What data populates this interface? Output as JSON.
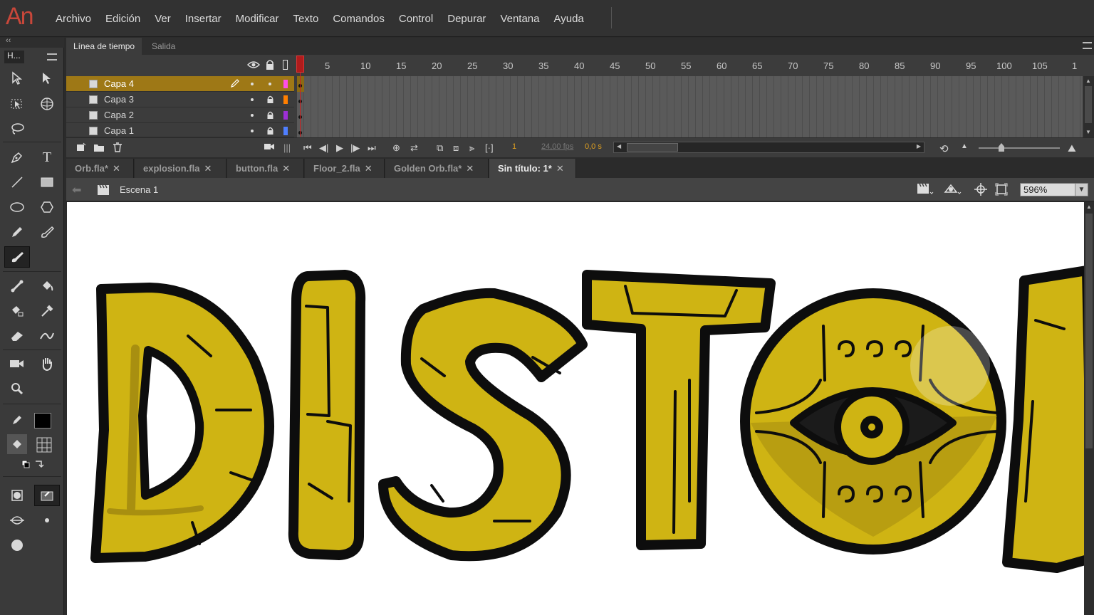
{
  "app": {
    "logo": "An"
  },
  "menu": [
    "Archivo",
    "Edición",
    "Ver",
    "Insertar",
    "Modificar",
    "Texto",
    "Comandos",
    "Control",
    "Depurar",
    "Ventana",
    "Ayuda"
  ],
  "toolbar": {
    "title": "H...",
    "tools": [
      "selection-icon",
      "subselection-icon",
      "free-transform-icon",
      "3d-rotation-icon",
      "lasso-icon",
      "pen-icon",
      "text-icon",
      "line-icon",
      "rectangle-icon",
      "oval-icon",
      "polystar-icon",
      "pencil-icon",
      "paint-brush-icon",
      "brush-icon",
      "bone-icon",
      "paint-bucket-icon",
      "ink-bottle-icon",
      "eyedropper-icon",
      "eraser-icon",
      "width-icon",
      "camera-icon",
      "hand-icon",
      "zoom-icon"
    ]
  },
  "timeline": {
    "tabs": [
      "Línea de tiempo",
      "Salida"
    ],
    "frame_numbers": [
      "1",
      "5",
      "10",
      "15",
      "20",
      "25",
      "30",
      "35",
      "40",
      "45",
      "50",
      "55",
      "60",
      "65",
      "70",
      "75",
      "80",
      "85",
      "90",
      "95",
      "100",
      "105",
      "1"
    ],
    "layers": [
      {
        "name": "Capa 4",
        "color": "#ff4ee8",
        "selected": true
      },
      {
        "name": "Capa 3",
        "color": "#ff7f00",
        "selected": false
      },
      {
        "name": "Capa 2",
        "color": "#9d2fd6",
        "selected": false
      },
      {
        "name": "Capa 1",
        "color": "#4f7fff",
        "selected": false
      }
    ],
    "current_frame": "1",
    "fps": "24,00 fps",
    "time": "0,0 s"
  },
  "doc_tabs": [
    {
      "label": "Orb.fla*",
      "active": false
    },
    {
      "label": "explosion.fla",
      "active": false
    },
    {
      "label": "button.fla",
      "active": false
    },
    {
      "label": "Floor_2.fla",
      "active": false
    },
    {
      "label": "Golden Orb.fla*",
      "active": false
    },
    {
      "label": "Sin título: 1*",
      "active": true
    }
  ],
  "editbar": {
    "scene": "Escena 1",
    "zoom": "596%"
  },
  "colors": {
    "accent_layer": "#9e7816",
    "gold": "#cfb413",
    "gold_dark": "#a88f10",
    "stroke": "#0d0d0d"
  }
}
